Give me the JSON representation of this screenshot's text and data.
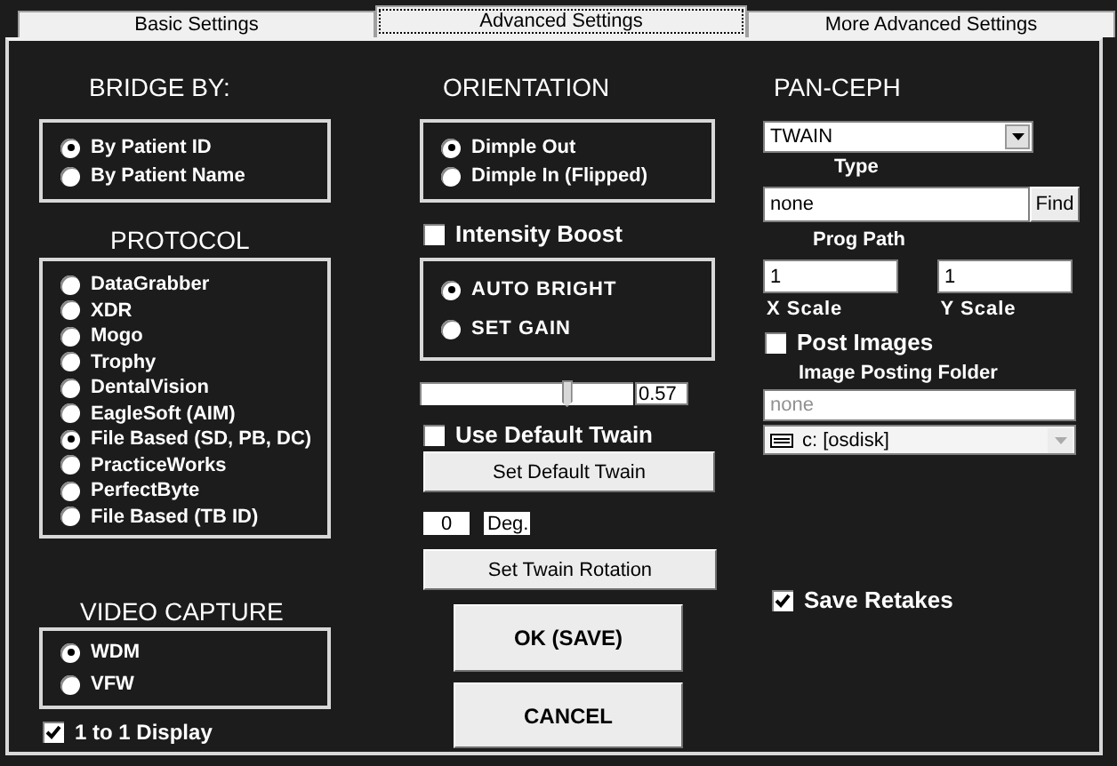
{
  "tabs": [
    {
      "label": "Basic Settings",
      "selected": false
    },
    {
      "label": "Advanced Settings",
      "selected": true
    },
    {
      "label": "More Advanced Settings",
      "selected": false
    }
  ],
  "bridge_by": {
    "heading": "BRIDGE BY:",
    "options": [
      {
        "label": "By Patient ID",
        "selected": true
      },
      {
        "label": "By Patient Name",
        "selected": false
      }
    ]
  },
  "protocol": {
    "heading": "PROTOCOL",
    "options": [
      {
        "label": "DataGrabber",
        "selected": false
      },
      {
        "label": "XDR",
        "selected": false
      },
      {
        "label": "Mogo",
        "selected": false
      },
      {
        "label": "Trophy",
        "selected": false
      },
      {
        "label": "DentalVision",
        "selected": false
      },
      {
        "label": "EagleSoft (AIM)",
        "selected": false
      },
      {
        "label": "File Based (SD, PB, DC)",
        "selected": true
      },
      {
        "label": "PracticeWorks",
        "selected": false
      },
      {
        "label": "PerfectByte",
        "selected": false
      },
      {
        "label": "File Based (TB ID)",
        "selected": false
      }
    ]
  },
  "video_capture": {
    "heading": "VIDEO CAPTURE",
    "options": [
      {
        "label": "WDM",
        "selected": true
      },
      {
        "label": "VFW",
        "selected": false
      }
    ]
  },
  "one_to_one_display": {
    "label": "1 to 1 Display",
    "checked": true
  },
  "orientation": {
    "heading": "ORIENTATION",
    "options": [
      {
        "label": "Dimple Out",
        "selected": true
      },
      {
        "label": "Dimple In (Flipped)",
        "selected": false
      }
    ]
  },
  "intensity_boost": {
    "label": "Intensity Boost",
    "checked": false
  },
  "brightness": {
    "options": [
      {
        "label": "AUTO BRIGHT",
        "selected": true
      },
      {
        "label": "SET GAIN",
        "selected": false
      }
    ]
  },
  "gain_slider": {
    "level": 0.69,
    "reading": "0.57"
  },
  "use_default_twain": {
    "label": "Use Default Twain",
    "checked": false
  },
  "set_default_twain_button": "Set Default Twain",
  "rotation": {
    "value": "0",
    "unit": "Deg."
  },
  "set_twain_rotation_button": "Set Twain Rotation",
  "ok_button": "OK (SAVE)",
  "cancel_button": "CANCEL",
  "pan_ceph": {
    "heading": "PAN-CEPH",
    "type": {
      "value": "TWAIN",
      "label": "Type"
    },
    "prog_path": {
      "value": "none",
      "button": "Find",
      "label": "Prog Path"
    },
    "x_scale": {
      "value": "1",
      "label": "X Scale"
    },
    "y_scale": {
      "value": "1",
      "label": "Y Scale"
    },
    "post_images": {
      "label": "Post Images",
      "checked": false
    },
    "image_posting_folder": {
      "label": "Image Posting Folder",
      "value": "none",
      "disabled": true
    },
    "drive": {
      "value": "c: [osdisk]",
      "disabled": true
    }
  },
  "save_retakes": {
    "label": "Save Retakes",
    "checked": true
  }
}
